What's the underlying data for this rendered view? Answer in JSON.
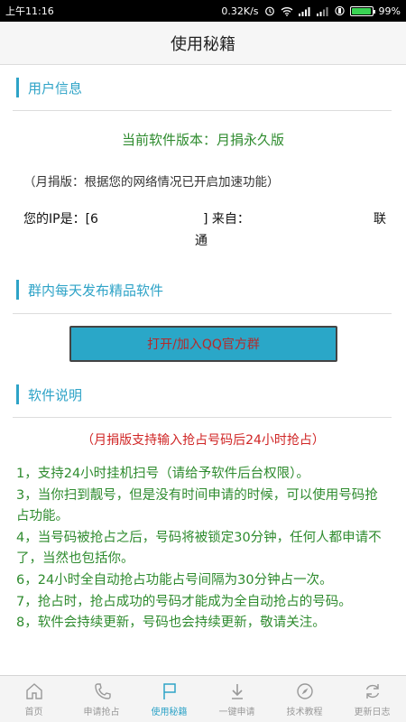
{
  "status_bar": {
    "time": "上午11:16",
    "network_speed": "0.32K/s",
    "battery_percent": "99%",
    "battery_level": 0.99
  },
  "title": "使用秘籍",
  "sections": {
    "user_info": {
      "heading": "用户信息",
      "version": "当前软件版本：月捐永久版",
      "note": "（月捐版：根据您的网络情况已开启加速功能）",
      "ip_label": "您的IP是：[6",
      "ip_close": "] 来自：",
      "isp_part1": "联",
      "isp_part2": "通"
    },
    "group": {
      "heading": "群内每天发布精品软件",
      "button_label": "打开/加入QQ官方群"
    },
    "instructions": {
      "heading": "软件说明",
      "red_note": "（月捐版支持输入抢占号码后24小时抢占）",
      "items": [
        "1，支持24小时挂机扫号（请给予软件后台权限）。",
        "3，当你扫到靓号，但是没有时间申请的时候，可以使用号码抢占功能。",
        "4，当号码被抢占之后，号码将被锁定30分钟，任何人都申请不了，当然也包括你。",
        "6，24小时全自动抢占功能占号间隔为30分钟占一次。",
        "7，抢占时，抢占成功的号码才能成为全自动抢占的号码。",
        "8，软件会持续更新，号码也会持续更新，敬请关注。"
      ]
    }
  },
  "bottom_nav": [
    {
      "label": "首页",
      "icon": "home-icon"
    },
    {
      "label": "申请抢占",
      "icon": "phone-icon"
    },
    {
      "label": "使用秘籍",
      "icon": "flag-icon",
      "active": true
    },
    {
      "label": "一键申请",
      "icon": "download-arrow-icon"
    },
    {
      "label": "技术教程",
      "icon": "compass-icon"
    },
    {
      "label": "更新日志",
      "icon": "refresh-icon"
    }
  ],
  "colors": {
    "accent": "#2ea3c7",
    "green_text": "#2e8b2e",
    "red_text": "#d02626",
    "button_bg": "#2aa7c8"
  }
}
